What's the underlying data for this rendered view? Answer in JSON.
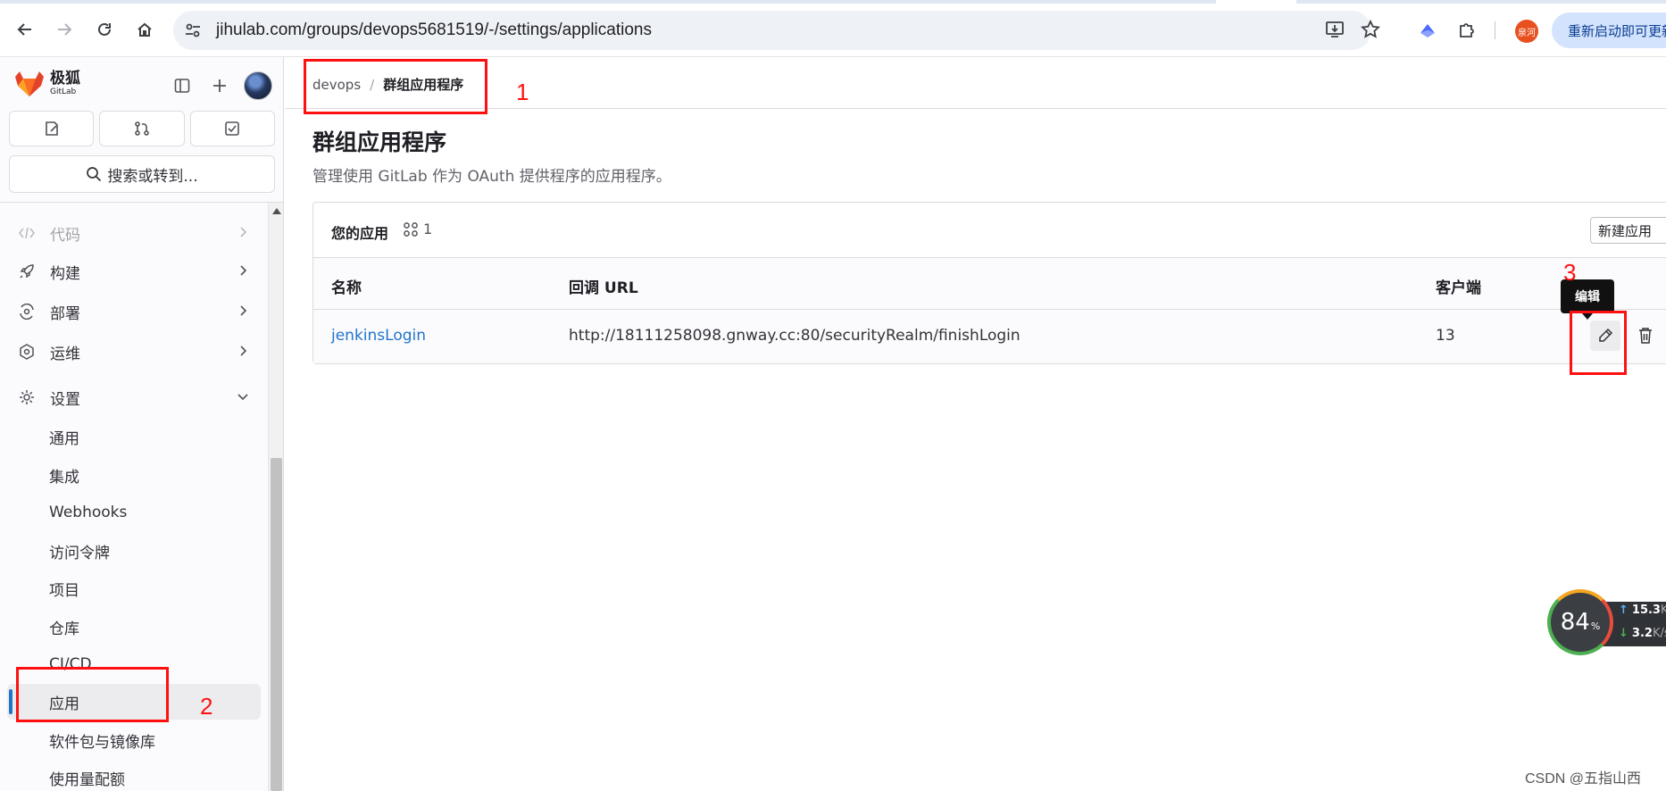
{
  "browser": {
    "url": "jihulab.com/groups/devops5681519/-/settings/applications",
    "profile_label": "泉河",
    "restart_label": "重新启动即可更新"
  },
  "sidebar": {
    "brand_cn": "极狐",
    "brand_en": "GitLab",
    "search_label": "搜索或转到...",
    "nav": [
      {
        "label": "代码",
        "icon": "code-icon"
      },
      {
        "label": "构建",
        "icon": "rocket-icon"
      },
      {
        "label": "部署",
        "icon": "deployments-icon"
      },
      {
        "label": "运维",
        "icon": "monitor-icon"
      },
      {
        "label": "设置",
        "icon": "gear-icon"
      }
    ],
    "settings_items": [
      "通用",
      "集成",
      "Webhooks",
      "访问令牌",
      "项目",
      "仓库",
      "CI/CD",
      "应用",
      "软件包与镜像库",
      "使用量配额"
    ],
    "active_item": "应用"
  },
  "breadcrumb": {
    "parent": "devops",
    "separator": "/",
    "current": "群组应用程序"
  },
  "page": {
    "title": "群组应用程序",
    "description": "管理使用 GitLab 作为 OAuth 提供程序的应用程序。"
  },
  "apps_card": {
    "title": "您的应用",
    "count": "1",
    "new_button": "新建应用",
    "columns": [
      "名称",
      "回调 URL",
      "客户端"
    ],
    "rows": [
      {
        "name": "jenkinsLogin",
        "callback_url": "http://18111258098.gnway.cc:80/securityRealm/finishLogin",
        "clients": "13"
      }
    ],
    "edit_tooltip": "编辑"
  },
  "annotations": [
    "1",
    "2",
    "3"
  ],
  "speed_widget": {
    "percent": "84",
    "percent_unit": "%",
    "up": "15.3",
    "down": "3.2",
    "unit": "K/s"
  },
  "watermark": "CSDN @五指山西",
  "colors": {
    "link": "#1f75cb",
    "annotation": "#ff1010",
    "active_bar": "#1f75cb"
  }
}
